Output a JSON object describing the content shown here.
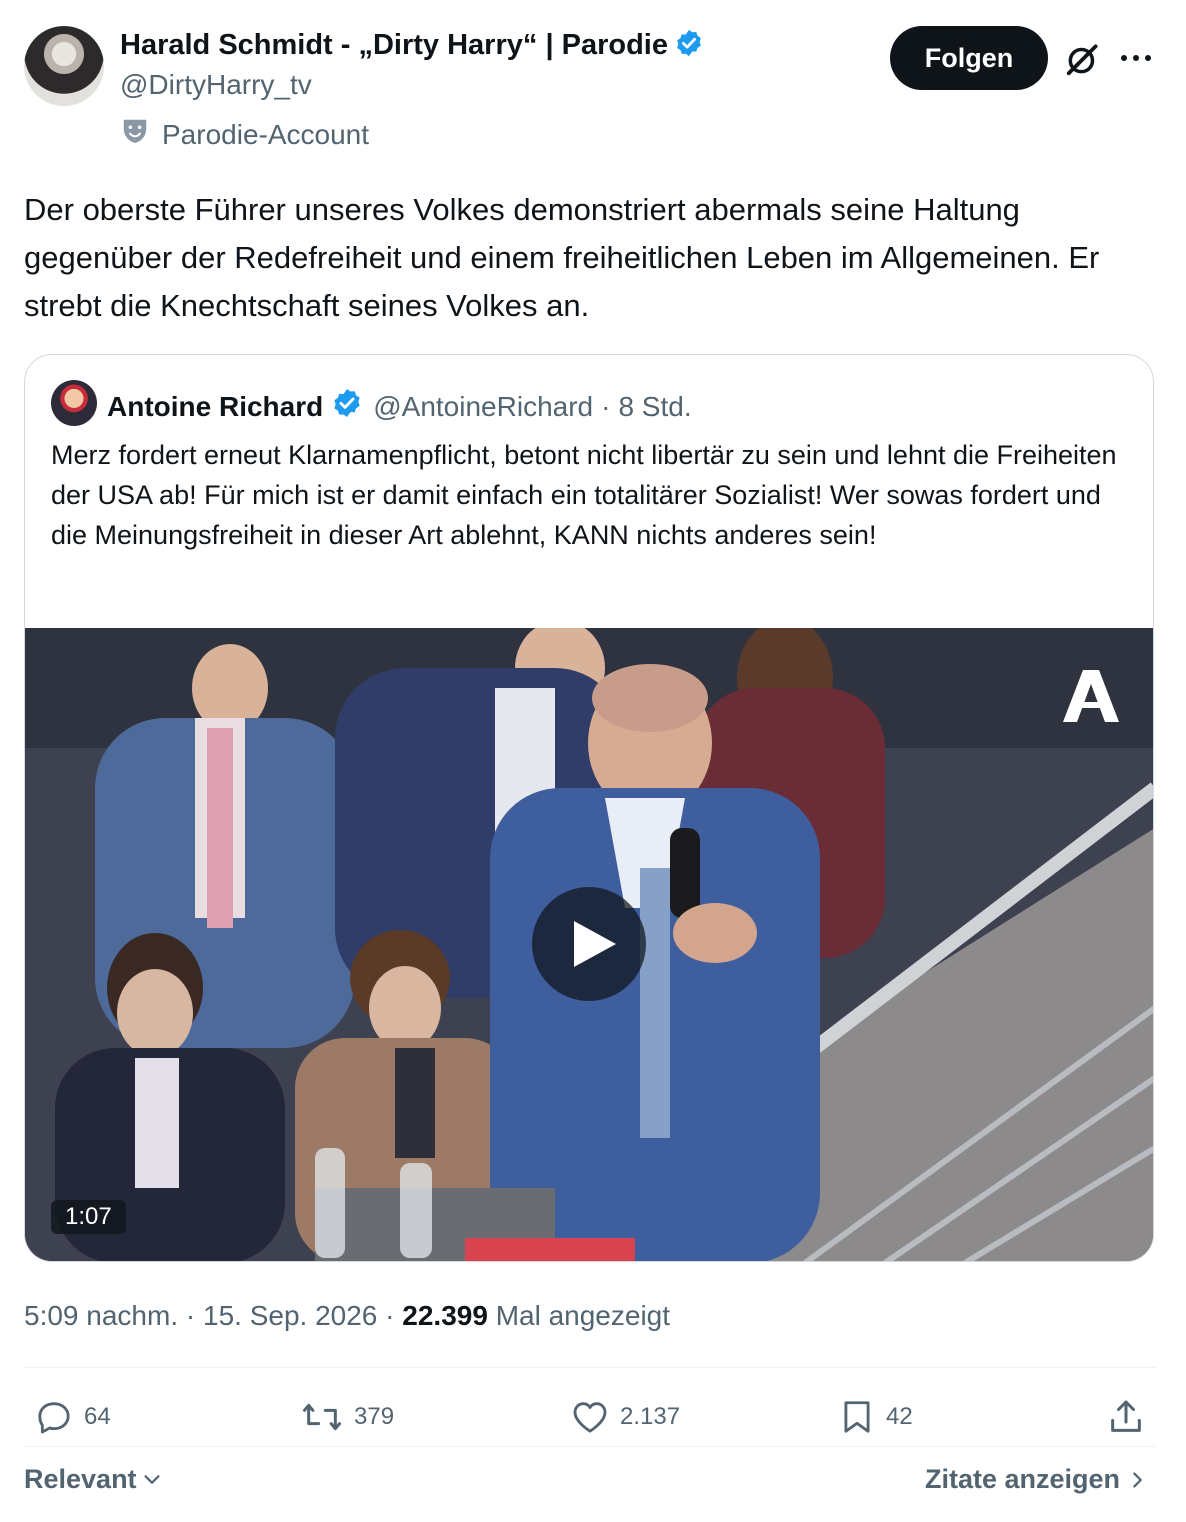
{
  "tweet": {
    "author_name": "Harald Schmidt - „Dirty Harry“ | Parodie",
    "handle": "@DirtyHarry_tv",
    "parody_label": "Parodie-Account",
    "follow_label": "Folgen",
    "text": "Der oberste Führer unseres Volkes demonstriert abermals seine Haltung gegenüber der Redefreiheit und einem freiheitlichen Leben im Allgemeinen. Er strebt die Knechtschaft seines Volkes an.",
    "time": "5:09 nachm.",
    "date": "15. Sep. 2026",
    "views": "22.399",
    "views_label": "Mal angezeigt"
  },
  "quote": {
    "name": "Antoine Richard",
    "handle": "@AntoineRichard",
    "age": "8 Std.",
    "text": "Merz fordert erneut  Klarnamenpflicht, betont nicht libertär zu sein und lehnt die Freiheiten der USA ab! Für mich ist er damit einfach ein totalitärer Sozialist! Wer sowas fordert und die Meinungsfreiheit in dieser Art ablehnt, KANN nichts anderes sein!",
    "video_duration": "1:07",
    "video_logo": "A"
  },
  "actions": {
    "replies": "64",
    "reposts": "379",
    "likes": "2.137",
    "bookmarks": "42"
  },
  "footer": {
    "sort_label": "Relevant",
    "quotes_label": "Zitate anzeigen"
  },
  "colors": {
    "text": "#0f1419",
    "secondary": "#536471",
    "verified": "#1d9bf0",
    "border": "#cfd9de",
    "follow_bg": "#0f1419"
  },
  "icons": [
    "verified-badge-icon",
    "parody-mask-icon",
    "grok-icon",
    "more-icon",
    "play-icon",
    "reply-icon",
    "repost-icon",
    "like-icon",
    "bookmark-icon",
    "share-icon",
    "chevron-down-icon",
    "chevron-right-icon"
  ]
}
